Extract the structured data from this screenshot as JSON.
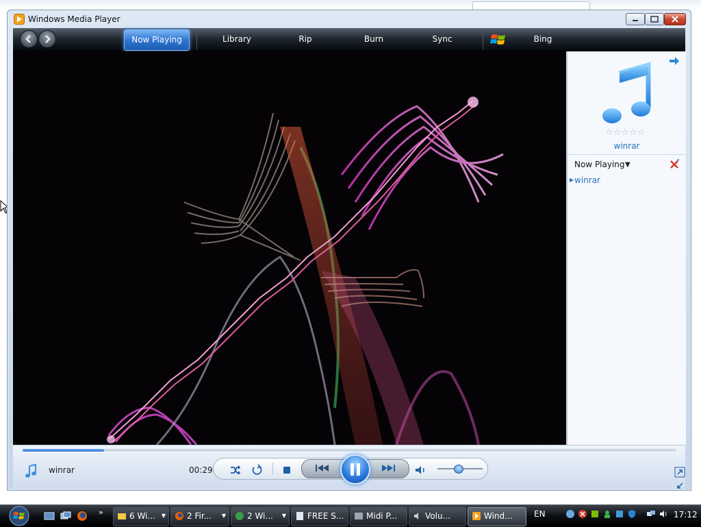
{
  "window": {
    "title": "Windows Media Player",
    "controls": {
      "minimize": "minimize",
      "maximize": "maximize",
      "close": "close"
    }
  },
  "navbar": {
    "tabs": [
      {
        "label": "Now Playing",
        "active": true
      },
      {
        "label": "Library"
      },
      {
        "label": "Rip"
      },
      {
        "label": "Burn"
      },
      {
        "label": "Sync"
      },
      {
        "label": "Bing"
      }
    ]
  },
  "now_playing_pane": {
    "album_title": "winrar",
    "rating_stars": "☆☆☆☆☆",
    "rating": 0,
    "list_header": "Now Playing",
    "dropdown_glyph": "▼",
    "playlist": [
      {
        "title": "winrar"
      }
    ]
  },
  "player": {
    "media_name": "winrar",
    "elapsed": "00:29",
    "progress_fraction": 0.125,
    "volume_fraction": 0.45,
    "state": "playing"
  },
  "taskbar": {
    "quicklaunch_more": "»",
    "tasks": [
      {
        "label": "6 Wi...",
        "icon": "folder-icon",
        "dropdown": true
      },
      {
        "label": "2 Fir...",
        "icon": "firefox-icon",
        "dropdown": true
      },
      {
        "label": "2 Wi...",
        "icon": "network-icon",
        "dropdown": true
      },
      {
        "label": "FREE S...",
        "icon": "document-icon"
      },
      {
        "label": "Midi P...",
        "icon": "app-icon"
      },
      {
        "label": "Volu...",
        "icon": "speaker-icon"
      },
      {
        "label": "Wind...",
        "icon": "media-player-icon",
        "active": true
      }
    ],
    "language": "EN",
    "clock": "17:12"
  },
  "colors": {
    "accent_blue": "#2f76d2",
    "link_blue": "#2a6fbf",
    "navbar_dark": "#1f262e"
  }
}
